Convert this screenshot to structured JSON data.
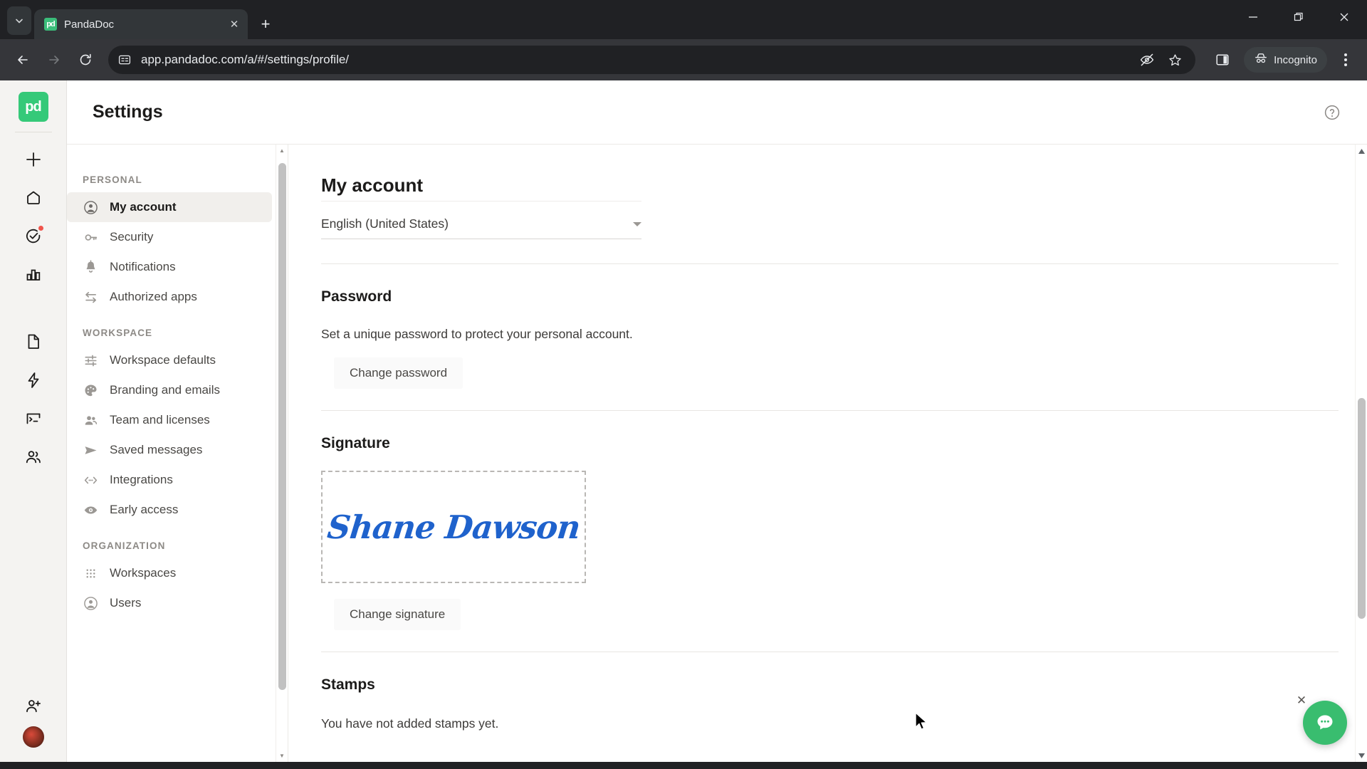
{
  "browser": {
    "tab": {
      "title": "PandaDoc",
      "favicon_label": "pd",
      "close_label": "✕"
    },
    "tab_list_icon": "chevron-down-icon",
    "new_tab_label": "+",
    "window_controls": {
      "minimize": "—",
      "maximize": "❐",
      "close": "✕"
    },
    "nav": {
      "back": "←",
      "forward": "→",
      "reload": "⟳"
    },
    "omnibox": {
      "url": "app.pandadoc.com/a/#/settings/profile/",
      "site_info_icon": "page-info-icon",
      "tracking_protection_icon": "eye-slash-icon",
      "bookmark_icon": "star-icon"
    },
    "side_panel_icon": "side-panel-icon",
    "incognito": {
      "label": "Incognito",
      "icon": "incognito-hat-icon"
    },
    "menu_icon": "three-dots-menu-icon"
  },
  "rail": {
    "brand_label": "pd",
    "items": [
      {
        "name": "create-new",
        "icon": "plus-icon"
      },
      {
        "name": "home",
        "icon": "home-icon"
      },
      {
        "name": "tasks",
        "icon": "check-circle-icon",
        "badge": true
      },
      {
        "name": "reporting",
        "icon": "bar-chart-icon"
      },
      {
        "name": "documents",
        "icon": "document-icon"
      },
      {
        "name": "automation",
        "icon": "lightning-bolt-icon"
      },
      {
        "name": "forms",
        "icon": "form-terminal-icon"
      },
      {
        "name": "contacts",
        "icon": "people-icon"
      }
    ],
    "invite_icon": "person-add-icon",
    "avatar": "user-avatar"
  },
  "header": {
    "title": "Settings",
    "help_icon": "help-circle-icon"
  },
  "settings_nav": {
    "sections": [
      {
        "label": "PERSONAL",
        "items": [
          {
            "label": "My account",
            "icon": "account-circle-icon",
            "active": true
          },
          {
            "label": "Security",
            "icon": "key-icon",
            "active": false
          },
          {
            "label": "Notifications",
            "icon": "bell-icon",
            "active": false
          },
          {
            "label": "Authorized apps",
            "icon": "transfer-arrows-icon",
            "active": false
          }
        ]
      },
      {
        "label": "WORKSPACE",
        "items": [
          {
            "label": "Workspace defaults",
            "icon": "sliders-icon",
            "active": false
          },
          {
            "label": "Branding and emails",
            "icon": "palette-icon",
            "active": false
          },
          {
            "label": "Team and licenses",
            "icon": "group-icon",
            "active": false
          },
          {
            "label": "Saved messages",
            "icon": "send-icon",
            "active": false
          },
          {
            "label": "Integrations",
            "icon": "code-brackets-icon",
            "active": false
          },
          {
            "label": "Early access",
            "icon": "eye-icon",
            "active": false
          }
        ]
      },
      {
        "label": "ORGANIZATION",
        "items": [
          {
            "label": "Workspaces",
            "icon": "grid-dots-icon",
            "active": false
          },
          {
            "label": "Users",
            "icon": "account-circle-icon",
            "active": false
          }
        ]
      }
    ]
  },
  "content": {
    "page_title": "My account",
    "language": {
      "value": "English (United States)",
      "caret_icon": "chevron-down-icon"
    },
    "password": {
      "heading": "Password",
      "description": "Set a unique password to protect your personal account.",
      "button": "Change password"
    },
    "signature": {
      "heading": "Signature",
      "value": "Shane Dawson",
      "button": "Change signature",
      "color": "#1f62cc"
    },
    "stamps": {
      "heading": "Stamps",
      "empty_text": "You have not added stamps yet."
    }
  },
  "chat": {
    "fab_icon": "chat-bubble-icon",
    "close_label": "✕",
    "accent_color": "#39bd6f"
  },
  "scrollbars": {
    "up_arrow": "▲",
    "down_arrow": "▼"
  }
}
